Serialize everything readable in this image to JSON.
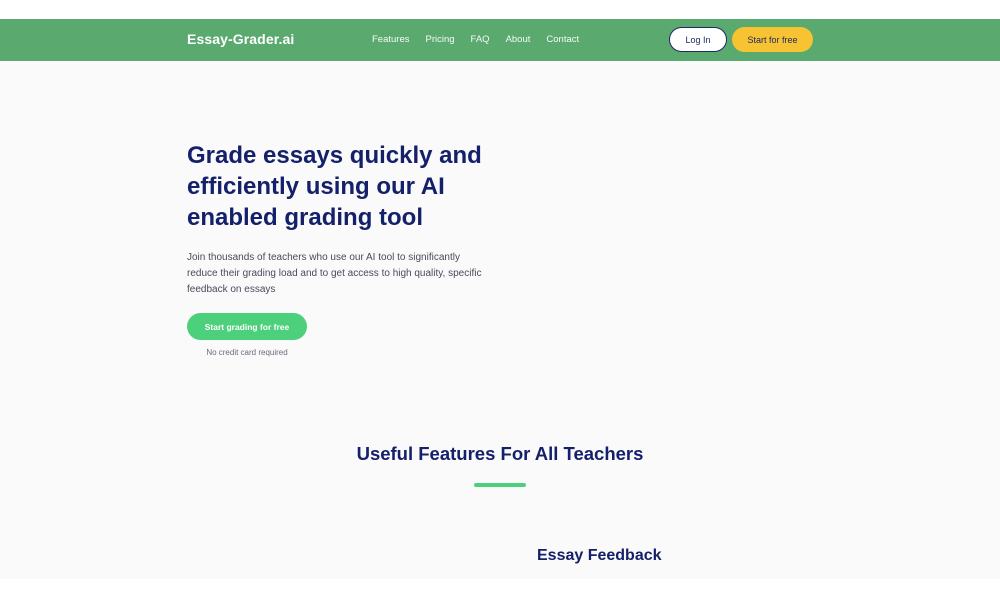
{
  "header": {
    "brand": "Essay-Grader.ai",
    "nav": [
      "Features",
      "Pricing",
      "FAQ",
      "About",
      "Contact"
    ],
    "login_label": "Log In",
    "start_label": "Start for free"
  },
  "hero": {
    "title": "Grade essays quickly and efficiently using our AI enabled grading tool",
    "description": "Join thousands of teachers who use our AI tool to significantly reduce their grading load and to get access to high quality, specific feedback on essays",
    "cta_label": "Start grading for free",
    "cta_note": "No credit card required"
  },
  "features": {
    "title": "Useful Features For All Teachers",
    "first_feature_title": "Essay Feedback"
  },
  "colors": {
    "nav_green": "#5aa96f",
    "accent_green": "#4cd07c",
    "cta_yellow": "#f7c332",
    "heading_navy": "#15206b"
  }
}
